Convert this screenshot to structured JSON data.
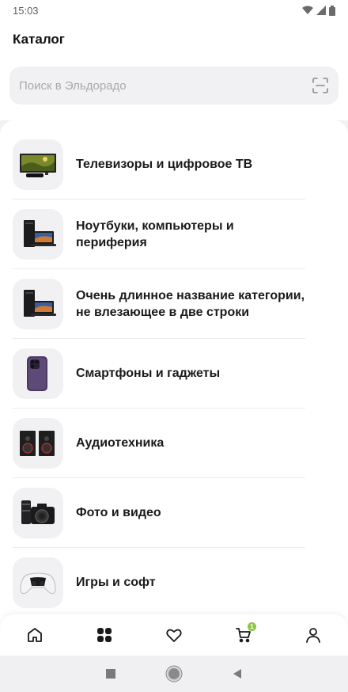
{
  "status_bar": {
    "time": "15:03"
  },
  "header": {
    "title": "Каталог"
  },
  "search": {
    "placeholder": "Поиск в Эльдорадо",
    "scan_icon": "scan-icon"
  },
  "categories": [
    {
      "label": "Телевизоры и цифровое ТВ",
      "icon": "tv-icon"
    },
    {
      "label": "Ноутбуки, компьютеры  и периферия",
      "icon": "computer-icon"
    },
    {
      "label": "Очень длинное название категории, не влезающее в две строки",
      "icon": "computer-icon"
    },
    {
      "label": "Смартфоны и гаджеты",
      "icon": "smartphone-icon"
    },
    {
      "label": "Аудиотехника",
      "icon": "speakers-icon"
    },
    {
      "label": "Фото и видео",
      "icon": "camera-icon"
    },
    {
      "label": "Игры и софт",
      "icon": "gamepad-icon"
    }
  ],
  "bottom_nav": {
    "items": [
      "home-icon",
      "catalog-icon",
      "favorites-icon",
      "cart-icon",
      "profile-icon"
    ],
    "cart_badge": "1",
    "badge_color": "#8dc63f"
  }
}
